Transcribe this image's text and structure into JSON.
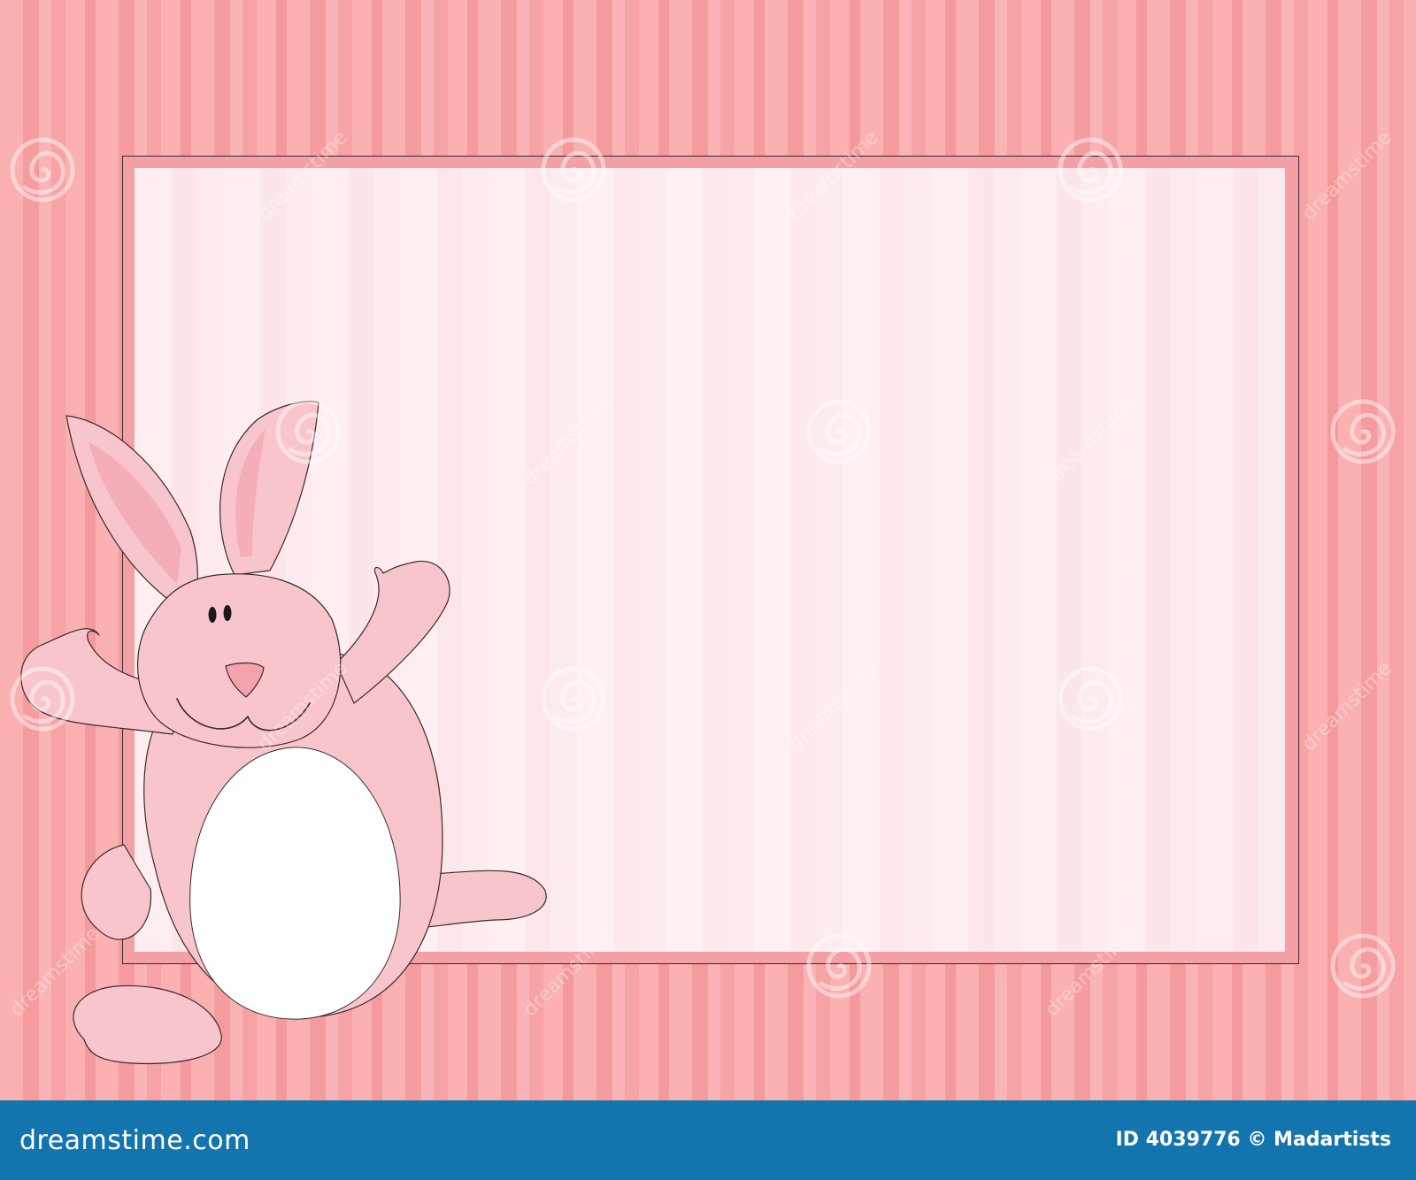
{
  "watermark": {
    "brand": "dreamstime.com",
    "repeat_text": "dreamstime",
    "spiral_icon": "dreamstime-spiral-icon"
  },
  "footer": {
    "brand": "dreamstime.com",
    "credit": "ID 4039776 © Madartists",
    "background_color": "#1474ae"
  },
  "illustration": {
    "subject": "pink-bunny-icon",
    "colors": {
      "background_stripe": "#f8a9aa",
      "panel": "#ffeef0",
      "bunny_body": "#f9c5cc",
      "bunny_belly": "#ffffff",
      "nose": "#f2a3ae"
    }
  }
}
